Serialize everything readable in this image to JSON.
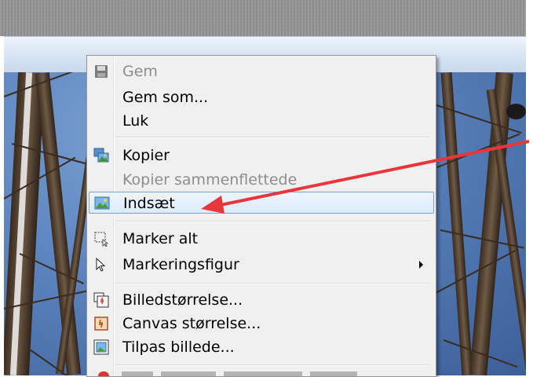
{
  "menu": {
    "items": [
      {
        "label": "Gem",
        "icon": "floppy-disk-icon",
        "disabled": true
      },
      {
        "label": "Gem som...",
        "icon": "",
        "disabled": false
      },
      {
        "label": "Luk",
        "icon": "",
        "disabled": false
      },
      {
        "label": "Kopier",
        "icon": "copy-image-icon",
        "disabled": false
      },
      {
        "label": "Kopier sammenflettede",
        "icon": "",
        "disabled": true
      },
      {
        "label": "Indsæt",
        "icon": "paste-image-icon",
        "disabled": false,
        "highlighted": true
      },
      {
        "label": "Marker alt",
        "icon": "select-all-icon",
        "disabled": false
      },
      {
        "label": "Markeringsfigur",
        "icon": "cursor-icon",
        "disabled": false,
        "has_submenu": true
      },
      {
        "label": "Billedstørrelse...",
        "icon": "image-size-icon",
        "disabled": false
      },
      {
        "label": "Canvas størrelse...",
        "icon": "canvas-size-icon",
        "disabled": false
      },
      {
        "label": "Tilpas billede...",
        "icon": "fit-image-icon",
        "disabled": false
      }
    ]
  },
  "annotation": {
    "color": "#e8363a"
  }
}
